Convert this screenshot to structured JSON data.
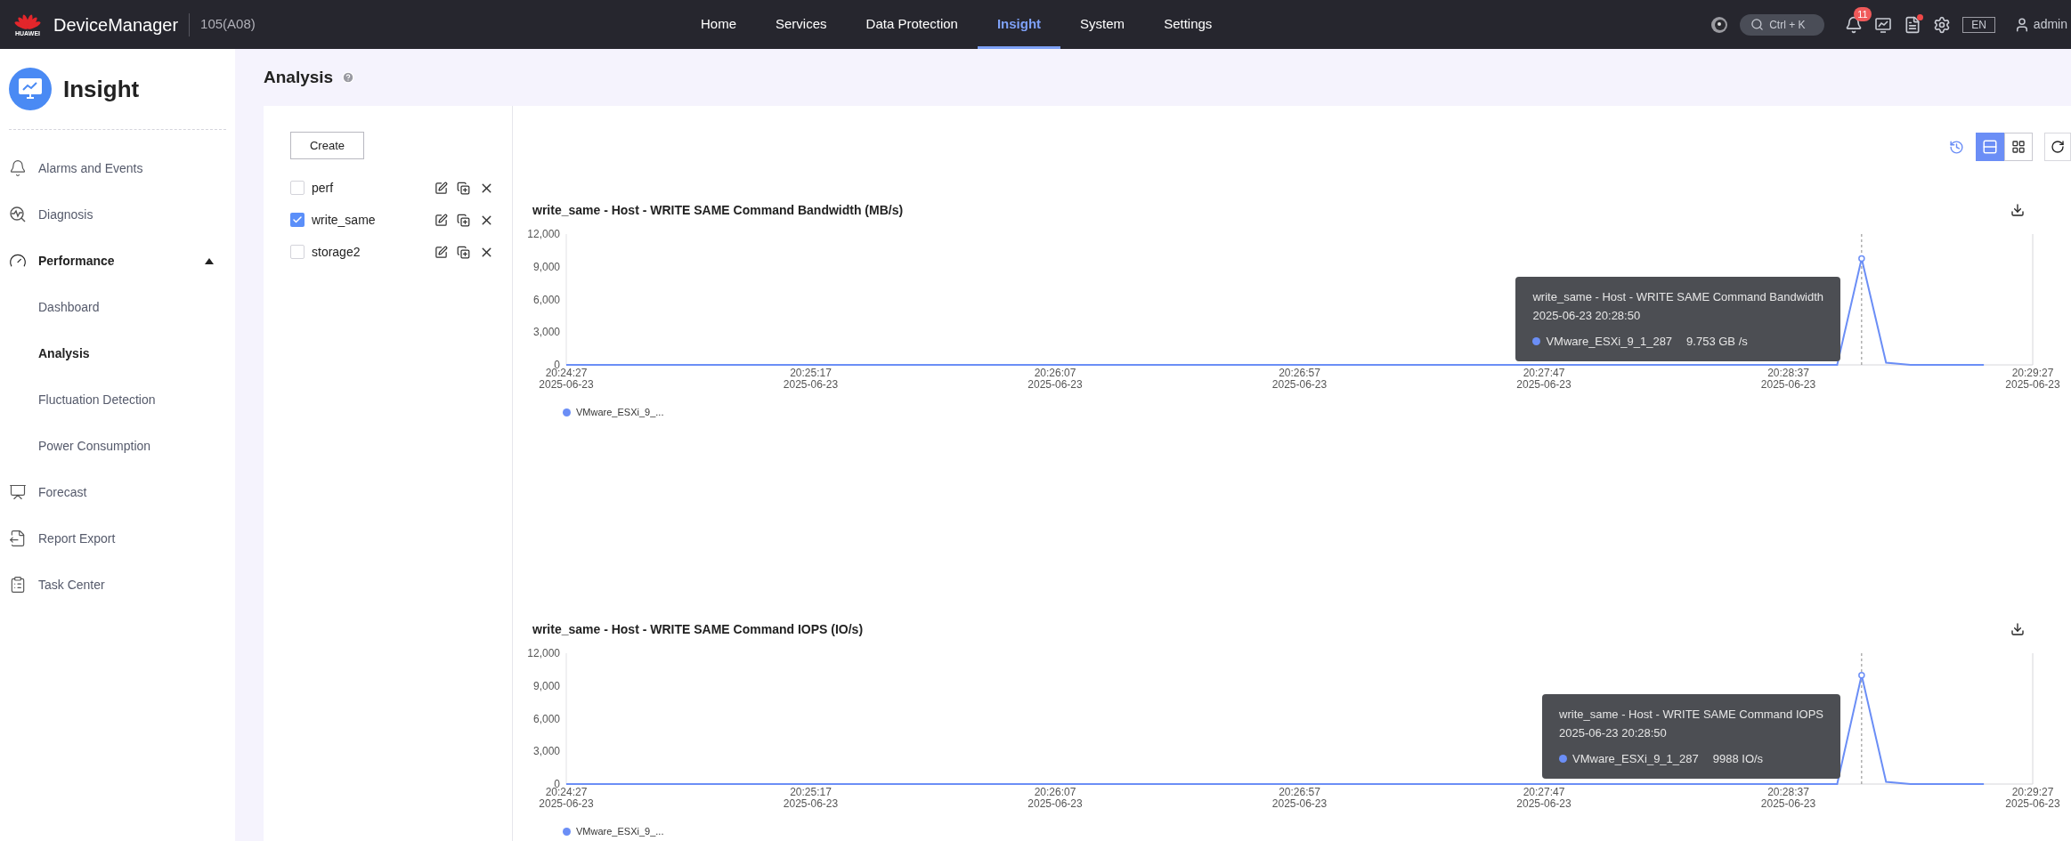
{
  "header": {
    "brand": "HUAWEI",
    "app_name": "DeviceManager",
    "device": "105(A08)",
    "nav": [
      {
        "label": "Home",
        "selected": false
      },
      {
        "label": "Services",
        "selected": false
      },
      {
        "label": "Data Protection",
        "selected": false
      },
      {
        "label": "Insight",
        "selected": true
      },
      {
        "label": "System",
        "selected": false
      },
      {
        "label": "Settings",
        "selected": false
      }
    ],
    "search": {
      "placeholder": "Ctrl + K"
    },
    "notification_count": "11",
    "reports_unread": true,
    "language": "EN",
    "user": "admin"
  },
  "sidebar": {
    "title": "Insight",
    "items": [
      {
        "label": "Alarms and Events"
      },
      {
        "label": "Diagnosis"
      },
      {
        "label": "Performance",
        "expanded": true,
        "children": [
          {
            "label": "Dashboard",
            "selected": false
          },
          {
            "label": "Analysis",
            "selected": true
          },
          {
            "label": "Fluctuation Detection",
            "selected": false
          },
          {
            "label": "Power Consumption",
            "selected": false
          }
        ]
      },
      {
        "label": "Forecast"
      },
      {
        "label": "Report Export"
      },
      {
        "label": "Task Center"
      }
    ]
  },
  "page_title": "Analysis",
  "create_button": "Create",
  "analyses": [
    {
      "name": "perf",
      "checked": false
    },
    {
      "name": "write_same",
      "checked": true
    },
    {
      "name": "storage2",
      "checked": false
    }
  ],
  "view_modes": [
    {
      "selected": true
    },
    {
      "selected": false
    }
  ],
  "charts": [
    {
      "chart_data": {
        "type": "line",
        "title": "write_same - Host - WRITE SAME Command Bandwidth (MB/s)",
        "categories": [
          "20:24:27 2025-06-23",
          null,
          null,
          null,
          null,
          null,
          null,
          null,
          null,
          null,
          "20:25:17 2025-06-23",
          null,
          null,
          null,
          null,
          null,
          null,
          null,
          null,
          null,
          "20:26:07 2025-06-23",
          null,
          null,
          null,
          null,
          null,
          null,
          null,
          null,
          null,
          "20:26:57 2025-06-23",
          null,
          null,
          null,
          null,
          null,
          null,
          null,
          null,
          null,
          "20:27:47 2025-06-23",
          null,
          null,
          null,
          null,
          null,
          null,
          null,
          null,
          null,
          "20:28:37 2025-06-23",
          null,
          null,
          null,
          null,
          null,
          null,
          null,
          null,
          null,
          "20:29:27 2025-06-23"
        ],
        "series": [
          {
            "name": "VMware_ESXi_9_...",
            "color": "#6b8ef6",
            "values": [
              0,
              0,
              0,
              0,
              0,
              0,
              0,
              0,
              0,
              0,
              0,
              0,
              0,
              0,
              0,
              0,
              0,
              0,
              0,
              0,
              0,
              0,
              0,
              0,
              0,
              0,
              0,
              0,
              0,
              0,
              0,
              0,
              0,
              0,
              0,
              0,
              0,
              0,
              0,
              0,
              0,
              0,
              0,
              0,
              0,
              0,
              0,
              0,
              0,
              0,
              0,
              0,
              0,
              9753,
              200,
              0,
              0,
              0,
              0,
              null,
              null
            ]
          }
        ],
        "ylim": [
          0,
          12000
        ],
        "yticks": [
          {
            "value": 0,
            "label": "0"
          },
          {
            "value": 3000,
            "label": "3,000"
          },
          {
            "value": 6000,
            "label": "6,000"
          },
          {
            "value": 9000,
            "label": "9,000"
          },
          {
            "value": 12000,
            "label": "12,000"
          }
        ]
      },
      "tooltip": {
        "title": "write_same - Host - WRITE SAME Command Bandwidth",
        "time": "2025-06-23 20:28:50",
        "series": "VMware_ESXi_9_1_287",
        "value": "9.753 GB /s"
      }
    },
    {
      "chart_data": {
        "type": "line",
        "title": "write_same - Host - WRITE SAME Command IOPS (IO/s)",
        "categories": [
          "20:24:27 2025-06-23",
          null,
          null,
          null,
          null,
          null,
          null,
          null,
          null,
          null,
          "20:25:17 2025-06-23",
          null,
          null,
          null,
          null,
          null,
          null,
          null,
          null,
          null,
          "20:26:07 2025-06-23",
          null,
          null,
          null,
          null,
          null,
          null,
          null,
          null,
          null,
          "20:26:57 2025-06-23",
          null,
          null,
          null,
          null,
          null,
          null,
          null,
          null,
          null,
          "20:27:47 2025-06-23",
          null,
          null,
          null,
          null,
          null,
          null,
          null,
          null,
          null,
          "20:28:37 2025-06-23",
          null,
          null,
          null,
          null,
          null,
          null,
          null,
          null,
          null,
          "20:29:27 2025-06-23"
        ],
        "series": [
          {
            "name": "VMware_ESXi_9_...",
            "color": "#6b8ef6",
            "values": [
              0,
              0,
              0,
              0,
              0,
              0,
              0,
              0,
              0,
              0,
              0,
              0,
              0,
              0,
              0,
              0,
              0,
              0,
              0,
              0,
              0,
              0,
              0,
              0,
              0,
              0,
              0,
              0,
              0,
              0,
              0,
              0,
              0,
              0,
              0,
              0,
              0,
              0,
              0,
              0,
              0,
              0,
              0,
              0,
              0,
              0,
              0,
              0,
              0,
              0,
              0,
              0,
              0,
              9988,
              200,
              0,
              0,
              0,
              0,
              null,
              null
            ]
          }
        ],
        "ylim": [
          0,
          12000
        ],
        "yticks": [
          {
            "value": 0,
            "label": "0"
          },
          {
            "value": 3000,
            "label": "3,000"
          },
          {
            "value": 6000,
            "label": "6,000"
          },
          {
            "value": 9000,
            "label": "9,000"
          },
          {
            "value": 12000,
            "label": "12,000"
          }
        ]
      },
      "tooltip": {
        "title": "write_same - Host - WRITE SAME Command IOPS",
        "time": "2025-06-23 20:28:50",
        "series": "VMware_ESXi_9_1_287",
        "value": "9988 IO/s"
      }
    }
  ]
}
